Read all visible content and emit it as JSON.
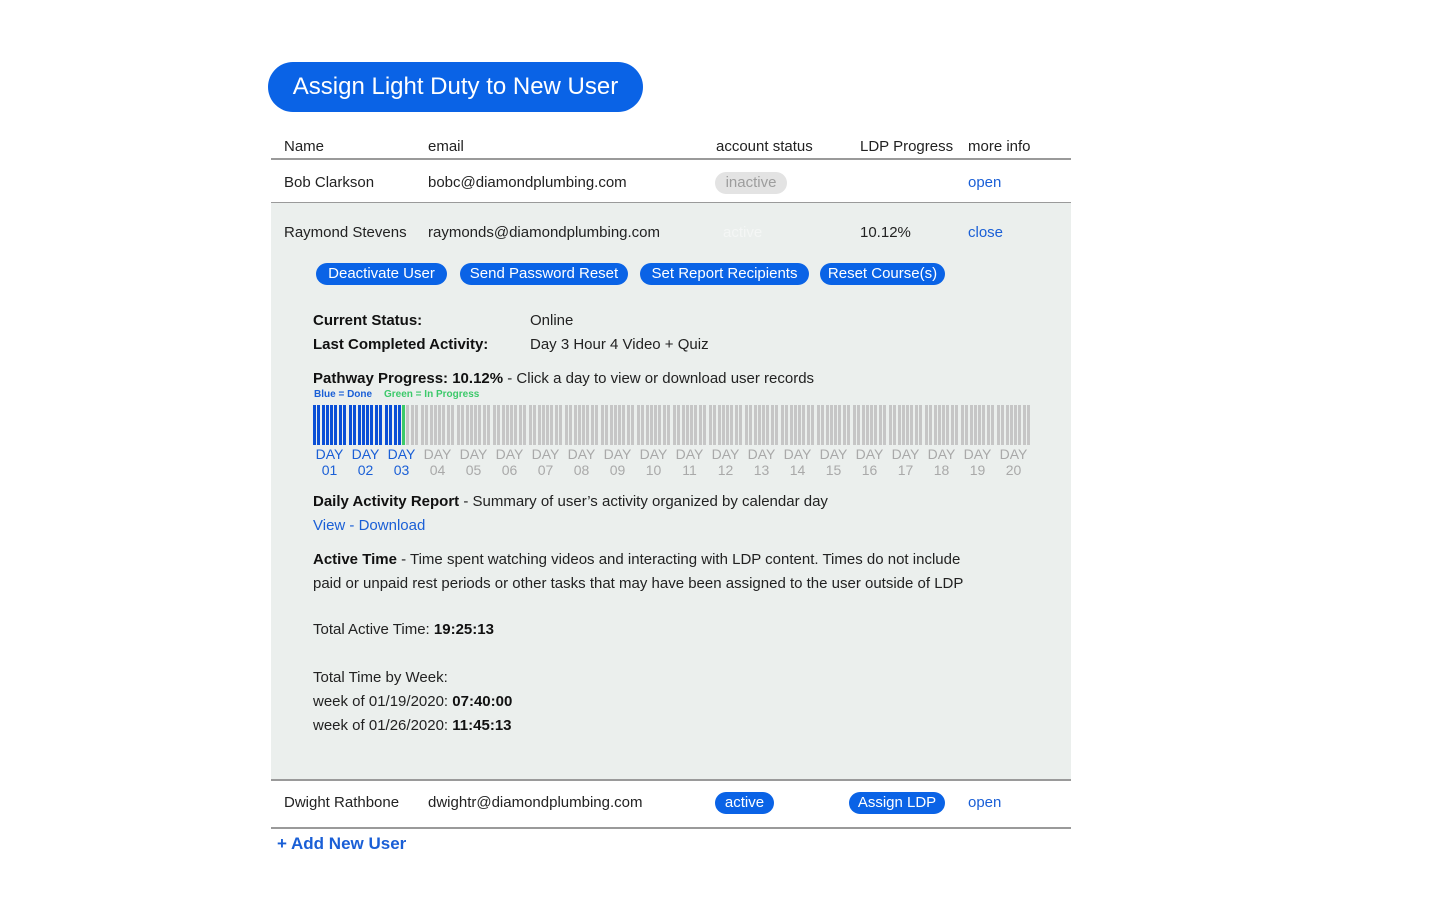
{
  "page": {
    "title_button": "Assign Light Duty to New User"
  },
  "table": {
    "headers": {
      "name": "Name",
      "email": "email",
      "status": "account status",
      "progress": "LDP Progress",
      "more": "more info"
    },
    "rows": [
      {
        "name": "Bob Clarkson",
        "email": "bobc@diamondplumbing.com",
        "status": "inactive",
        "progress": "",
        "more": "open"
      },
      {
        "name": "Raymond Stevens",
        "email": "raymonds@diamondplumbing.com",
        "status": "active",
        "progress": "10.12%",
        "more": "close"
      },
      {
        "name": "Dwight Rathbone",
        "email": "dwightr@diamondplumbing.com",
        "status": "active",
        "progress": "Assign LDP",
        "more": "open"
      }
    ]
  },
  "detail": {
    "actions": [
      "Deactivate User",
      "Send Password Reset",
      "Set Report Recipients",
      "Reset Course(s)"
    ],
    "current_status_label": "Current Status:",
    "current_status_value": "Online",
    "last_activity_label": "Last Completed Activity:",
    "last_activity_value": "Day 3 Hour 4 Video + Quiz",
    "pathway_label": "Pathway Progress: 10.12%",
    "pathway_hint": " - Click a day to view or download user records",
    "pathway_progress_pct": 10.12,
    "legend_done": "Blue = Done",
    "legend_progress": "Green = In Progress",
    "days": [
      {
        "l1": "DAY",
        "l2": "01",
        "state": "done",
        "done_segments": 8
      },
      {
        "l1": "DAY",
        "l2": "02",
        "state": "done",
        "done_segments": 8
      },
      {
        "l1": "DAY",
        "l2": "03",
        "state": "done",
        "done_segments": 4,
        "in_progress_segments": 1
      },
      {
        "l1": "DAY",
        "l2": "04",
        "state": "todo"
      },
      {
        "l1": "DAY",
        "l2": "05",
        "state": "todo"
      },
      {
        "l1": "DAY",
        "l2": "06",
        "state": "todo"
      },
      {
        "l1": "DAY",
        "l2": "07",
        "state": "todo"
      },
      {
        "l1": "DAY",
        "l2": "08",
        "state": "todo"
      },
      {
        "l1": "DAY",
        "l2": "09",
        "state": "todo"
      },
      {
        "l1": "DAY",
        "l2": "10",
        "state": "todo"
      },
      {
        "l1": "DAY",
        "l2": "11",
        "state": "todo"
      },
      {
        "l1": "DAY",
        "l2": "12",
        "state": "todo"
      },
      {
        "l1": "DAY",
        "l2": "13",
        "state": "todo"
      },
      {
        "l1": "DAY",
        "l2": "14",
        "state": "todo"
      },
      {
        "l1": "DAY",
        "l2": "15",
        "state": "todo"
      },
      {
        "l1": "DAY",
        "l2": "16",
        "state": "todo"
      },
      {
        "l1": "DAY",
        "l2": "17",
        "state": "todo"
      },
      {
        "l1": "DAY",
        "l2": "18",
        "state": "todo"
      },
      {
        "l1": "DAY",
        "l2": "19",
        "state": "todo"
      },
      {
        "l1": "DAY",
        "l2": "20",
        "state": "todo"
      }
    ],
    "daily_report_label": "Daily Activity Report",
    "daily_report_desc": " - Summary of user’s activity organized by calendar day",
    "view_link": "View",
    "link_sep": " - ",
    "download_link": "Download",
    "active_time_label": "Active Time",
    "active_time_line1": " - Time spent watching videos and interacting with LDP content. Times do not include",
    "active_time_line2": "paid or unpaid rest periods or other tasks that may have been assigned to the user outside of LDP",
    "total_active_label": "Total Active Time: ",
    "total_active_value": "19:25:13",
    "by_week_label": "Total Time by Week:",
    "weeks": [
      {
        "label": "week of 01/19/2020: ",
        "value": "07:40:00"
      },
      {
        "label": "week of 01/26/2020: ",
        "value": "11:45:13"
      }
    ]
  },
  "footer": {
    "add_user": "+ Add New User"
  },
  "colors": {
    "accent": "#0a63e6",
    "link": "#1a5fd6",
    "done": "#0a4fd6",
    "in_progress": "#3cc96a",
    "panel": "#ebefed"
  }
}
